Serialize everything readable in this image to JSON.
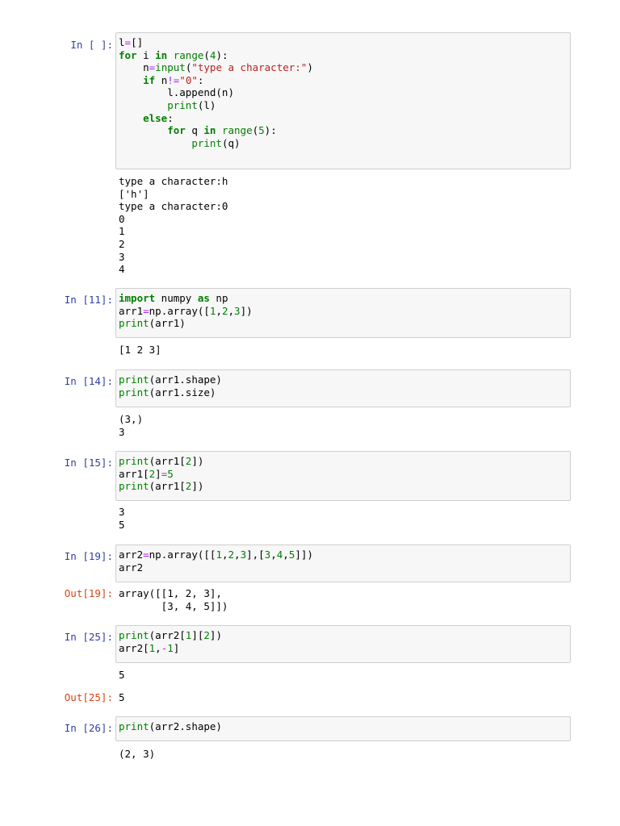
{
  "cells": [
    {
      "in_prompt": "In [ ]:",
      "code_lines": [
        [
          [
            "l",
            "tok"
          ],
          [
            "=",
            "op"
          ],
          [
            "[]",
            "tok"
          ]
        ],
        [
          [
            "for",
            "kw"
          ],
          [
            " i ",
            "tok"
          ],
          [
            "in",
            "kw"
          ],
          [
            " ",
            "tok"
          ],
          [
            "range",
            "bi"
          ],
          [
            "(",
            "tok"
          ],
          [
            "4",
            "num"
          ],
          [
            "):",
            "tok"
          ]
        ],
        [
          [
            "    n",
            "tok"
          ],
          [
            "=",
            "op"
          ],
          [
            "input",
            "bi"
          ],
          [
            "(",
            "tok"
          ],
          [
            "\"type a character:\"",
            "str"
          ],
          [
            ")",
            "tok"
          ]
        ],
        [
          [
            "    ",
            "tok"
          ],
          [
            "if",
            "kw"
          ],
          [
            " n",
            "tok"
          ],
          [
            "!=",
            "op"
          ],
          [
            "\"0\"",
            "str"
          ],
          [
            ":",
            "tok"
          ]
        ],
        [
          [
            "        l.append(n)",
            "tok"
          ]
        ],
        [
          [
            "        ",
            "tok"
          ],
          [
            "print",
            "bi"
          ],
          [
            "(l)",
            "tok"
          ]
        ],
        [
          [
            "    ",
            "tok"
          ],
          [
            "else",
            "kw"
          ],
          [
            ":",
            "tok"
          ]
        ],
        [
          [
            "        ",
            "tok"
          ],
          [
            "for",
            "kw"
          ],
          [
            " q ",
            "tok"
          ],
          [
            "in",
            "kw"
          ],
          [
            " ",
            "tok"
          ],
          [
            "range",
            "bi"
          ],
          [
            "(",
            "tok"
          ],
          [
            "5",
            "num"
          ],
          [
            "):",
            "tok"
          ]
        ],
        [
          [
            "            ",
            "tok"
          ],
          [
            "print",
            "bi"
          ],
          [
            "(q)",
            "tok"
          ]
        ],
        [
          [
            "",
            "tok"
          ]
        ]
      ],
      "stdout": "type a character:h\n['h']\ntype a character:0\n0\n1\n2\n3\n4"
    },
    {
      "in_prompt": "In [11]:",
      "code_lines": [
        [
          [
            "import",
            "kw"
          ],
          [
            " numpy ",
            "tok"
          ],
          [
            "as",
            "kw"
          ],
          [
            " np",
            "tok"
          ]
        ],
        [
          [
            "arr1",
            "tok"
          ],
          [
            "=",
            "op"
          ],
          [
            "np.array([",
            "tok"
          ],
          [
            "1",
            "num"
          ],
          [
            ",",
            "tok"
          ],
          [
            "2",
            "num"
          ],
          [
            ",",
            "tok"
          ],
          [
            "3",
            "num"
          ],
          [
            "])",
            "tok"
          ]
        ],
        [
          [
            "print",
            "bi"
          ],
          [
            "(arr1)",
            "tok"
          ]
        ]
      ],
      "stdout": "[1 2 3]"
    },
    {
      "in_prompt": "In [14]:",
      "code_lines": [
        [
          [
            "print",
            "bi"
          ],
          [
            "(arr1.shape)",
            "tok"
          ]
        ],
        [
          [
            "print",
            "bi"
          ],
          [
            "(arr1.size)",
            "tok"
          ]
        ]
      ],
      "stdout": "(3,)\n3"
    },
    {
      "in_prompt": "In [15]:",
      "code_lines": [
        [
          [
            "print",
            "bi"
          ],
          [
            "(arr1[",
            "tok"
          ],
          [
            "2",
            "num"
          ],
          [
            "])",
            "tok"
          ]
        ],
        [
          [
            "arr1[",
            "tok"
          ],
          [
            "2",
            "num"
          ],
          [
            "]",
            "tok"
          ],
          [
            "=",
            "op"
          ],
          [
            "5",
            "num"
          ]
        ],
        [
          [
            "print",
            "bi"
          ],
          [
            "(arr1[",
            "tok"
          ],
          [
            "2",
            "num"
          ],
          [
            "])",
            "tok"
          ]
        ]
      ],
      "stdout": "3\n5"
    },
    {
      "in_prompt": "In [19]:",
      "code_lines": [
        [
          [
            "arr2",
            "tok"
          ],
          [
            "=",
            "op"
          ],
          [
            "np.array([[",
            "tok"
          ],
          [
            "1",
            "num"
          ],
          [
            ",",
            "tok"
          ],
          [
            "2",
            "num"
          ],
          [
            ",",
            "tok"
          ],
          [
            "3",
            "num"
          ],
          [
            "],[",
            "tok"
          ],
          [
            "3",
            "num"
          ],
          [
            ",",
            "tok"
          ],
          [
            "4",
            "num"
          ],
          [
            ",",
            "tok"
          ],
          [
            "5",
            "num"
          ],
          [
            "]])",
            "tok"
          ]
        ],
        [
          [
            "arr2",
            "tok"
          ]
        ]
      ],
      "out_prompt": "Out[19]:",
      "result": "array([[1, 2, 3],\n       [3, 4, 5]])"
    },
    {
      "in_prompt": "In [25]:",
      "code_lines": [
        [
          [
            "print",
            "bi"
          ],
          [
            "(arr2[",
            "tok"
          ],
          [
            "1",
            "num"
          ],
          [
            "][",
            "tok"
          ],
          [
            "2",
            "num"
          ],
          [
            "])",
            "tok"
          ]
        ],
        [
          [
            "arr2[",
            "tok"
          ],
          [
            "1",
            "num"
          ],
          [
            ",",
            "tok"
          ],
          [
            "-",
            "op"
          ],
          [
            "1",
            "num"
          ],
          [
            "]",
            "tok"
          ]
        ]
      ],
      "stdout": "5",
      "out_prompt": "Out[25]:",
      "result": "5"
    },
    {
      "in_prompt": "In [26]:",
      "code_lines": [
        [
          [
            "print",
            "bi"
          ],
          [
            "(arr2.shape)",
            "tok"
          ]
        ]
      ],
      "stdout": "(2, 3)"
    }
  ]
}
